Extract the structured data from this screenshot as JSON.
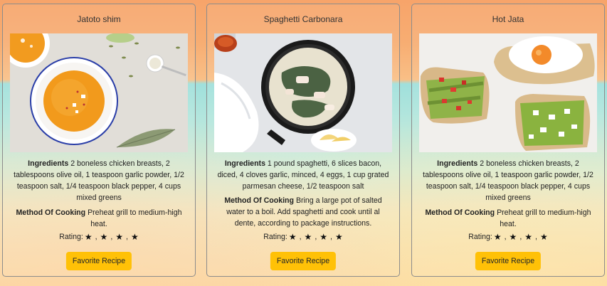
{
  "rating_label": "Rating:",
  "star_icon": "star-icon",
  "cards": [
    {
      "title": "Jatoto shim",
      "ingredients_label": "Ingredients",
      "ingredients": "2 boneless chicken breasts, 2 tablespoons olive oil, 1 teaspoon garlic powder, 1/2 teaspoon salt, 1/4 teaspoon black pepper, 4 cups mixed greens",
      "method_label": "Method Of Cooking",
      "method": "Preheat grill to medium-high heat.",
      "rating_stars": 4,
      "button_label": "Favorite Recipe"
    },
    {
      "title": "Spaghetti Carbonara",
      "ingredients_label": "Ingredients",
      "ingredients": "1 pound spaghetti, 6 slices bacon, diced, 4 cloves garlic, minced, 4 eggs, 1 cup grated parmesan cheese, 1/2 teaspoon salt",
      "method_label": "Method Of Cooking",
      "method": "Bring a large pot of salted water to a boil. Add spaghetti and cook until al dente, according to package instructions.",
      "rating_stars": 4,
      "button_label": "Favorite Recipe"
    },
    {
      "title": "Hot Jata",
      "ingredients_label": "Ingredients",
      "ingredients": "2 boneless chicken breasts, 2 tablespoons olive oil, 1 teaspoon garlic powder, 1/2 teaspoon salt, 1/4 teaspoon black pepper, 4 cups mixed greens",
      "method_label": "Method Of Cooking",
      "method": "Preheat grill to medium-high heat.",
      "rating_stars": 4,
      "button_label": "Favorite Recipe"
    }
  ],
  "colors": {
    "button_bg": "#ffc107",
    "card_border": "#8c8c8c",
    "bg_top": "#f7a46a",
    "bg_teal": "#9fe0dc",
    "bg_bottom": "#fbd9a7"
  }
}
